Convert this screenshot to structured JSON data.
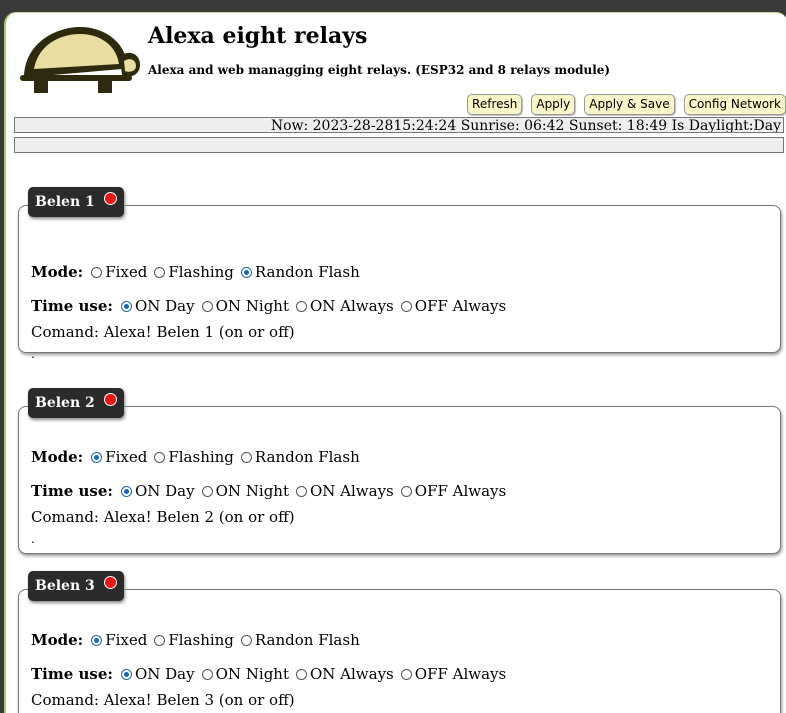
{
  "header": {
    "title": "Alexa eight relays",
    "subtitle": "Alexa and web managging eight relays. (ESP32 and 8 relays module)",
    "logo_icon": "turtle-icon"
  },
  "toolbar": {
    "refresh": "Refresh",
    "apply": "Apply",
    "apply_save": "Apply & Save",
    "config_network": "Config Network"
  },
  "status": {
    "text": "Now: 2023-28-2815:24:24 Sunrise: 06:42 Sunset: 18:49 Is Daylight:Day",
    "secondary": ""
  },
  "labels": {
    "mode": "Mode:",
    "time_use": "Time use:"
  },
  "mode_options": [
    "Fixed",
    "Flashing",
    "Randon Flash"
  ],
  "time_options": [
    "ON Day",
    "ON Night",
    "ON Always",
    "OFF Always"
  ],
  "colors": {
    "led_on": "#ee1111",
    "radio_selected": "#1a63c9",
    "button_bg": "#f8f6c8"
  },
  "relays": [
    {
      "name": "Belen 1",
      "mode_selected": 2,
      "time_selected": 0,
      "comand": "Comand: Alexa! Belen 1 (on or off)",
      "note": "."
    },
    {
      "name": "Belen 2",
      "mode_selected": 0,
      "time_selected": 0,
      "comand": "Comand: Alexa! Belen 2 (on or off)",
      "note": "."
    },
    {
      "name": "Belen 3",
      "mode_selected": 0,
      "time_selected": 0,
      "comand": "Comand: Alexa! Belen 3 (on or off)",
      "note": "."
    }
  ]
}
